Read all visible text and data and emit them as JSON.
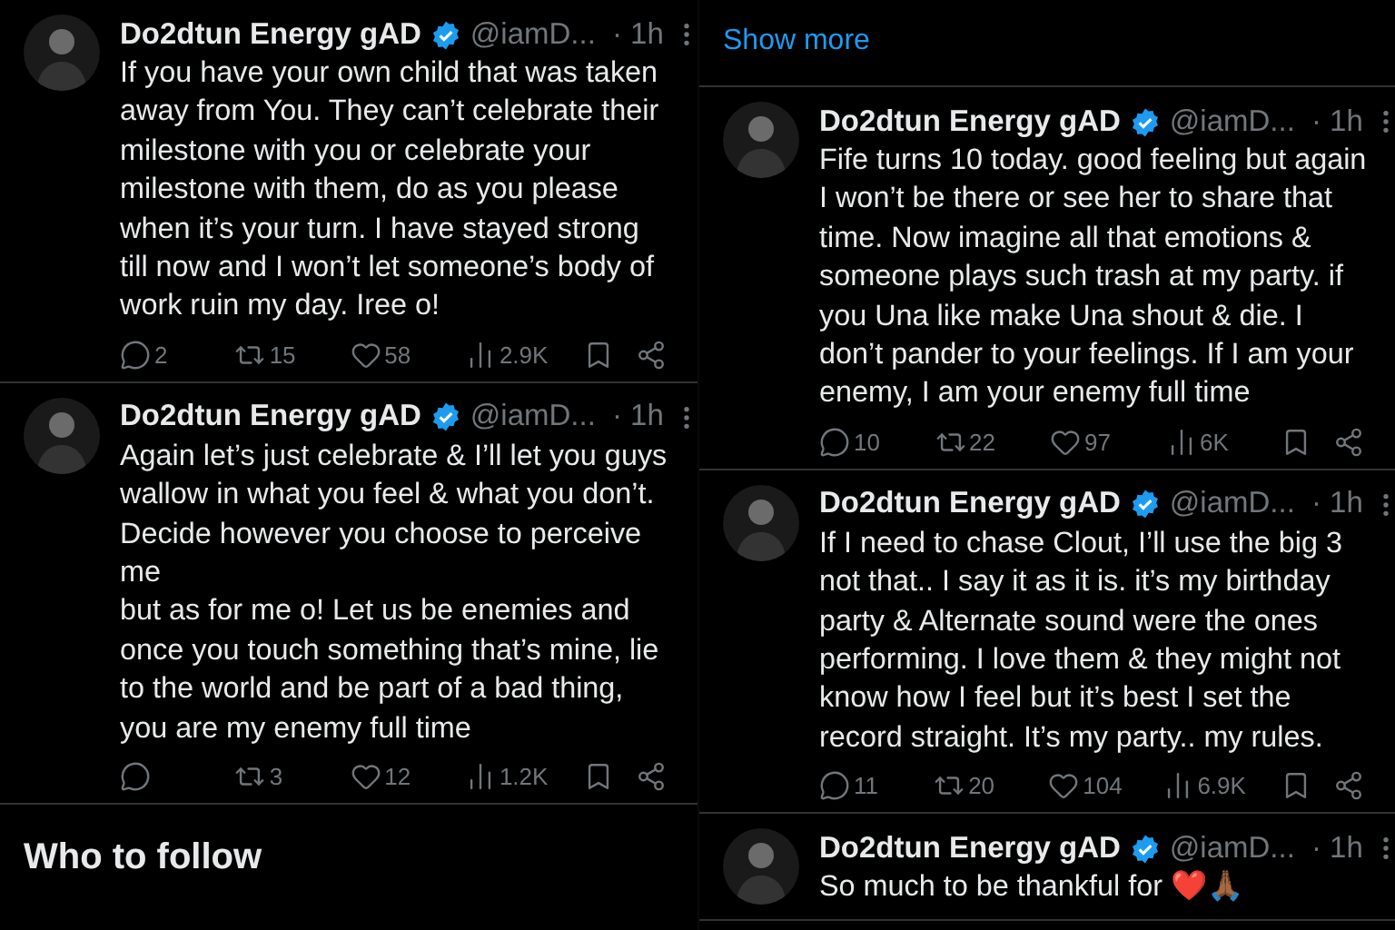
{
  "columns": [
    {
      "tweets": [
        {
          "name": "Do2dtun Energy gAD",
          "handle": "@iamD...",
          "time": "· 1h",
          "text": "If you have your own child that was taken away from You. They can’t celebrate their milestone with you or celebrate your milestone with them, do as you please when it’s your turn. I have stayed strong till now and I won’t let someone’s body of work ruin my day. Iree o!",
          "stats": {
            "replies": "2",
            "reposts": "15",
            "likes": "58",
            "views": "2.9K"
          }
        },
        {
          "name": "Do2dtun Energy gAD",
          "handle": "@iamD...",
          "time": "· 1h",
          "text": "Again let’s just celebrate & I’ll let you guys wallow in what you feel & what you don’t. Decide however you choose to perceive me\nbut as for me o! Let us be enemies and once you touch something that’s mine, lie to the world and be part of a bad thing, you are my enemy full time",
          "stats": {
            "reposts": "3",
            "likes": "12",
            "views": "1.2K"
          }
        }
      ],
      "section_heading": "Who to follow"
    },
    {
      "show_more": "Show more",
      "tweets": [
        {
          "name": "Do2dtun Energy gAD",
          "handle": "@iamD...",
          "time": "· 1h",
          "text": "Fife turns 10 today. good feeling but again I won’t be there or see her to share that time. Now imagine all that emotions & someone plays such trash at my party. if you Una like make Una shout & die. I don’t pander to your feelings. If I am your enemy, I am your enemy full time",
          "stats": {
            "replies": "10",
            "reposts": "22",
            "likes": "97",
            "views": "6K"
          }
        },
        {
          "name": "Do2dtun Energy gAD",
          "handle": "@iamD...",
          "time": "· 1h",
          "text": "If I need to chase Clout, I’ll use the big 3 not that.. I say it as it is. it’s my birthday party & Alternate sound were the ones performing. I love them & they might not know how I feel but it’s best I set the record straight. It’s my party.. my rules.",
          "stats": {
            "replies": "11",
            "reposts": "20",
            "likes": "104",
            "views": "6.9K"
          }
        },
        {
          "name": "Do2dtun Energy gAD",
          "handle": "@iamD...",
          "time": "· 1h",
          "text": "So much to be thankful for ❤️🙏🏾"
        }
      ]
    }
  ]
}
